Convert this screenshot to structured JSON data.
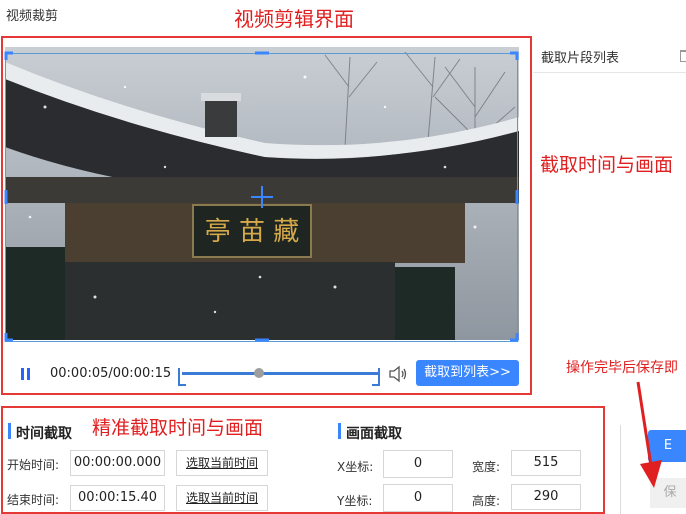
{
  "window": {
    "title": "视频裁剪"
  },
  "annotations": {
    "editor": "视频剪辑界面",
    "capture": "截取时间与画面",
    "save_hint": "操作完毕后保存即",
    "precise": "精准截取时间与画面"
  },
  "player": {
    "time_display": "00:00:05/00:00:15",
    "add_button": "截取到列表>>",
    "progress_fraction": 0.33,
    "plaque_text": "亭 苗 藏"
  },
  "side_panel": {
    "title": "截取片段列表"
  },
  "time_section": {
    "title": "时间截取",
    "start_label": "开始时间:",
    "start_value": "00:00:00.000",
    "end_label": "结束时间:",
    "end_value": "00:00:15.40",
    "select_current": "选取当前时间"
  },
  "frame_section": {
    "title": "画面截取",
    "x_label": "X坐标:",
    "x_value": "0",
    "y_label": "Y坐标:",
    "y_value": "0",
    "width_label": "宽度:",
    "width_value": "515",
    "height_label": "高度:",
    "height_value": "290"
  },
  "actions": {
    "save_label": "E",
    "save2_label": "保"
  },
  "colors": {
    "accent": "#3a86ff",
    "annotation": "#e02020"
  }
}
